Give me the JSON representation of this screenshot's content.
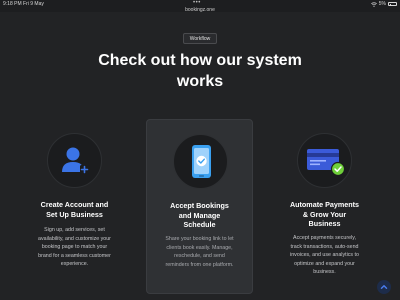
{
  "status_bar": {
    "time": "9:18 PM",
    "date": "Fri 9 May",
    "url": "bookingz.one",
    "battery": "5%"
  },
  "section": {
    "badge": "Workflow",
    "headline_line1": "Check out how our system",
    "headline_line2": "works"
  },
  "cards": [
    {
      "title_line1": "Create Account and",
      "title_line2": "Set Up Business",
      "desc_line1": "Sign up, add services, set",
      "desc_line2": "availability, and customize your",
      "desc_line3": "booking page to match your",
      "desc_line4": "brand for a seamless customer",
      "desc_line5": "experience.",
      "icon": "user-add-icon",
      "accent": "#3b74e6"
    },
    {
      "title_line1": "Accept Bookings",
      "title_line2": "and Manage",
      "title_line3": "Schedule",
      "desc_line1": "Share your booking link to let",
      "desc_line2": "clients book easily. Manage,",
      "desc_line3": "reschedule, and send",
      "desc_line4": "reminders from one platform.",
      "icon": "phone-check-icon",
      "accent": "#3aa0f0"
    },
    {
      "title_line1": "Automate Payments",
      "title_line2": "& Grow Your",
      "title_line3": "Business",
      "desc_line1": "Accept payments securely,",
      "desc_line2": "track transactions, auto-send",
      "desc_line3": "invoices, and use analytics to",
      "desc_line4": "optimize and expand your",
      "desc_line5": "business.",
      "icon": "credit-card-check-icon",
      "accent": "#6fcf3a"
    }
  ]
}
